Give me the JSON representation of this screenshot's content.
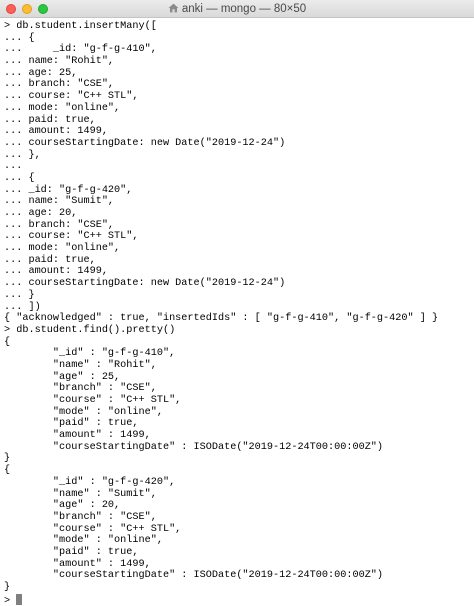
{
  "window": {
    "title": "anki — mongo — 80×50"
  },
  "terminal": {
    "lines": [
      "> db.student.insertMany([",
      "... {",
      "...     _id: \"g-f-g-410\",",
      "... name: \"Rohit\",",
      "... age: 25,",
      "... branch: \"CSE\",",
      "... course: \"C++ STL\",",
      "... mode: \"online\",",
      "... paid: true,",
      "... amount: 1499,",
      "... courseStartingDate: new Date(\"2019-12-24\")",
      "... },",
      "...",
      "... {",
      "... _id: \"g-f-g-420\",",
      "... name: \"Sumit\",",
      "... age: 20,",
      "... branch: \"CSE\",",
      "... course: \"C++ STL\",",
      "... mode: \"online\",",
      "... paid: true,",
      "... amount: 1499,",
      "... courseStartingDate: new Date(\"2019-12-24\")",
      "... }",
      "... ])",
      "{ \"acknowledged\" : true, \"insertedIds\" : [ \"g-f-g-410\", \"g-f-g-420\" ] }",
      "> db.student.find().pretty()",
      "{",
      "        \"_id\" : \"g-f-g-410\",",
      "        \"name\" : \"Rohit\",",
      "        \"age\" : 25,",
      "        \"branch\" : \"CSE\",",
      "        \"course\" : \"C++ STL\",",
      "        \"mode\" : \"online\",",
      "        \"paid\" : true,",
      "        \"amount\" : 1499,",
      "        \"courseStartingDate\" : ISODate(\"2019-12-24T00:00:00Z\")",
      "}",
      "{",
      "        \"_id\" : \"g-f-g-420\",",
      "        \"name\" : \"Sumit\",",
      "        \"age\" : 20,",
      "        \"branch\" : \"CSE\",",
      "        \"course\" : \"C++ STL\",",
      "        \"mode\" : \"online\",",
      "        \"paid\" : true,",
      "        \"amount\" : 1499,",
      "        \"courseStartingDate\" : ISODate(\"2019-12-24T00:00:00Z\")",
      "}"
    ],
    "prompt": "> "
  },
  "colors": {
    "close": "#ff5f57",
    "minimize": "#febc2e",
    "maximize": "#28c840",
    "background": "#ffffff",
    "text": "#000000",
    "cursor": "#7f7f7f"
  },
  "icons": {
    "title_icon": "house-icon"
  }
}
